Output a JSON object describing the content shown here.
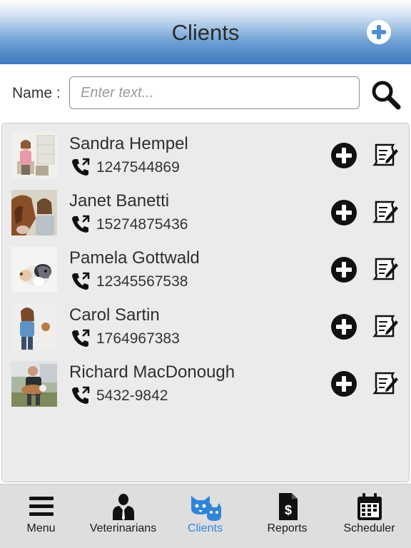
{
  "header": {
    "title": "Clients"
  },
  "search": {
    "label": "Name :",
    "placeholder": "Enter text...",
    "value": ""
  },
  "clients": [
    {
      "name": "Sandra Hempel",
      "phone": "1247544869"
    },
    {
      "name": "Janet Banetti",
      "phone": "15274875436"
    },
    {
      "name": "Pamela Gottwald",
      "phone": "12345567538"
    },
    {
      "name": "Carol Sartin",
      "phone": "1764967383"
    },
    {
      "name": "Richard MacDonough",
      "phone": "5432-9842"
    }
  ],
  "tabs": [
    {
      "label": "Menu",
      "icon": "hamburger-icon",
      "active": false
    },
    {
      "label": "Veterinarians",
      "icon": "veterinarian-icon",
      "active": false
    },
    {
      "label": "Clients",
      "icon": "pets-icon",
      "active": true
    },
    {
      "label": "Reports",
      "icon": "report-icon",
      "active": false
    },
    {
      "label": "Scheduler",
      "icon": "calendar-icon",
      "active": false
    }
  ],
  "colors": {
    "header_top": "#ffffff",
    "header_bottom": "#3f78bd",
    "active_tab": "#2f86d8",
    "list_background": "#ebebeb",
    "tabbar_background": "#dedede"
  }
}
